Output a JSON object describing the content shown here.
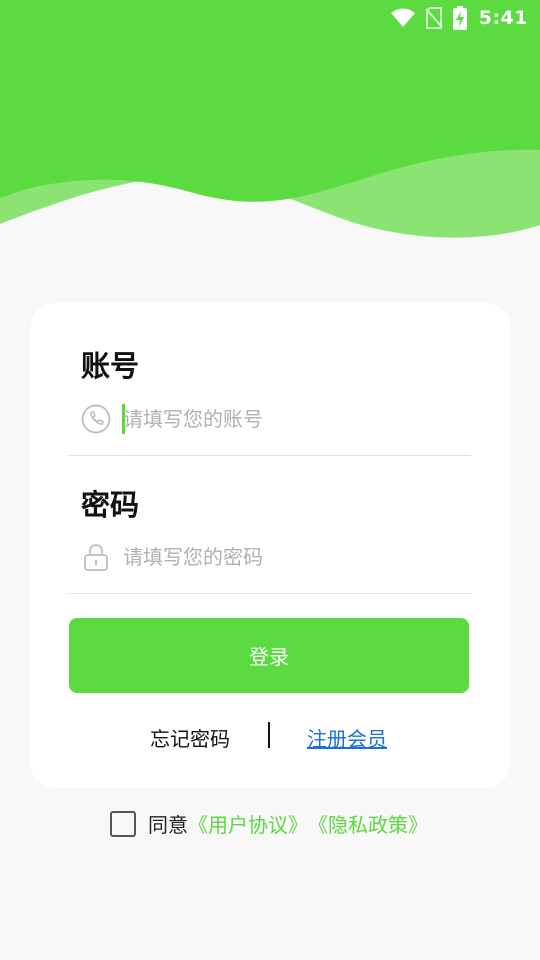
{
  "status_bar": {
    "time": "5:41",
    "icons": [
      "wifi-icon",
      "no-sim-icon",
      "battery-charging-icon"
    ]
  },
  "colors": {
    "brand_green": "#5bdb3f",
    "wave_light": "#8be373",
    "link_blue": "#1a6fd8",
    "background": "#f8f8f8"
  },
  "login_form": {
    "account": {
      "title": "账号",
      "placeholder": "请填写您的账号",
      "icon": "phone-icon"
    },
    "password": {
      "title": "密码",
      "placeholder": "请填写您的密码",
      "icon": "lock-icon"
    },
    "login_label": "登录",
    "forgot_label": "忘记密码",
    "register_label": "注册会员"
  },
  "agreement": {
    "prefix": "同意",
    "user_agreement": "《用户协议》",
    "privacy_policy": "《隐私政策》",
    "checked": false
  }
}
